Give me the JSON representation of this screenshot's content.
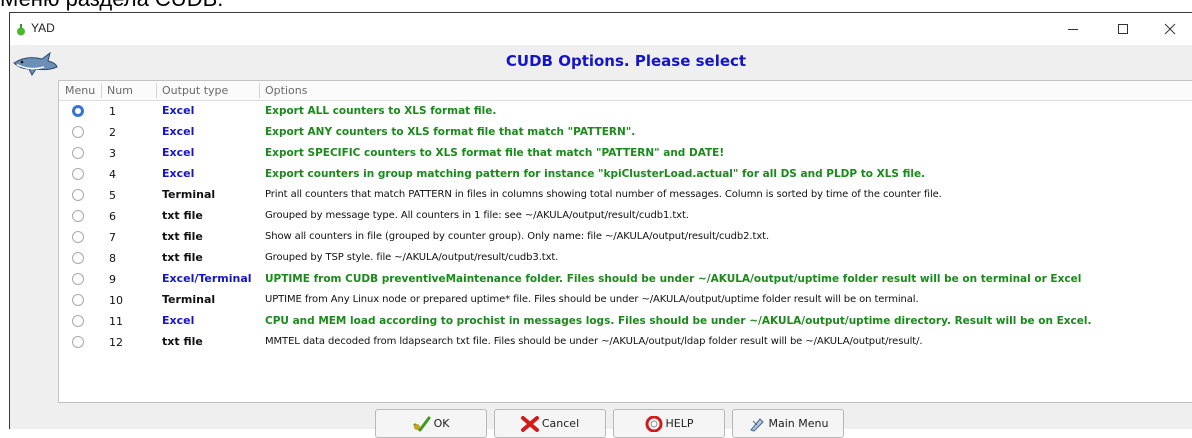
{
  "caption": "Меню раздела CUDB.",
  "window": {
    "title": "YAD",
    "dialog_title": "CUDB Options. Please select"
  },
  "columns": [
    "Menu",
    "Num",
    "Output type",
    "Options"
  ],
  "rows": [
    {
      "num": "1",
      "type": "Excel",
      "type_color": "blue",
      "option": "Export ALL counters to XLS format file.",
      "option_style": "green",
      "selected": true
    },
    {
      "num": "2",
      "type": "Excel",
      "type_color": "blue",
      "option": "Export ANY counters to XLS format file that match \"PATTERN\".",
      "option_style": "green",
      "selected": false
    },
    {
      "num": "3",
      "type": "Excel",
      "type_color": "blue",
      "option": "Export SPECIFIC counters to XLS format file that match \"PATTERN\" and DATE!",
      "option_style": "green",
      "selected": false
    },
    {
      "num": "4",
      "type": "Excel",
      "type_color": "blue",
      "option": "Export counters in group matching pattern for instance  \"kpiClusterLoad.actual\"  for all DS and PLDP to XLS file.",
      "option_style": "green",
      "selected": false
    },
    {
      "num": "5",
      "type": "Terminal",
      "type_color": "black",
      "option": "Print all counters that match PATTERN in files in columns showing total number of messages. Column is sorted by time of the counter file.",
      "option_style": "plain",
      "selected": false
    },
    {
      "num": "6",
      "type": "txt file",
      "type_color": "black",
      "option": "Grouped by message type. All counters in 1 file: see ~/AKULA/output/result/cudb1.txt.",
      "option_style": "plain",
      "selected": false
    },
    {
      "num": "7",
      "type": "txt file",
      "type_color": "black",
      "option": "Show all counters in file (grouped by counter group). Only name:  file ~/AKULA/output/result/cudb2.txt.",
      "option_style": "plain",
      "selected": false
    },
    {
      "num": "8",
      "type": "txt file",
      "type_color": "black",
      "option": "Grouped by TSP style. file ~/AKULA/output/result/cudb3.txt.",
      "option_style": "plain",
      "selected": false
    },
    {
      "num": "9",
      "type": "Excel/Terminal",
      "type_color": "blue",
      "option": "UPTIME from CUDB preventiveMaintenance folder. Files should be under ~/AKULA/output/uptime folder result will be on terminal or Excel",
      "option_style": "green",
      "selected": false
    },
    {
      "num": "10",
      "type": "Terminal",
      "type_color": "black",
      "option": "UPTIME from Any Linux node or prepared uptime* file. Files should be under ~/AKULA/output/uptime folder result will be on terminal.",
      "option_style": "plain",
      "selected": false
    },
    {
      "num": "11",
      "type": "Excel",
      "type_color": "blue",
      "option": "CPU and MEM load according to prochist in messages logs. Files should be under ~/AKULA/output/uptime directory. Result will be on Excel.",
      "option_style": "green",
      "selected": false
    },
    {
      "num": "12",
      "type": "txt file",
      "type_color": "black",
      "option": "MMTEL data  decoded from ldapsearch txt file. Files should be under ~/AKULA/output/ldap folder result will be ~/AKULA/output/result/.",
      "option_style": "plain",
      "selected": false
    }
  ],
  "buttons": {
    "ok": "OK",
    "cancel": "Cancel",
    "help": "HELP",
    "main_menu": "Main Menu"
  },
  "colors": {
    "accent_blue": "#1515c8",
    "option_green": "#1a8a1a",
    "radio_selected": "#3475cf"
  }
}
